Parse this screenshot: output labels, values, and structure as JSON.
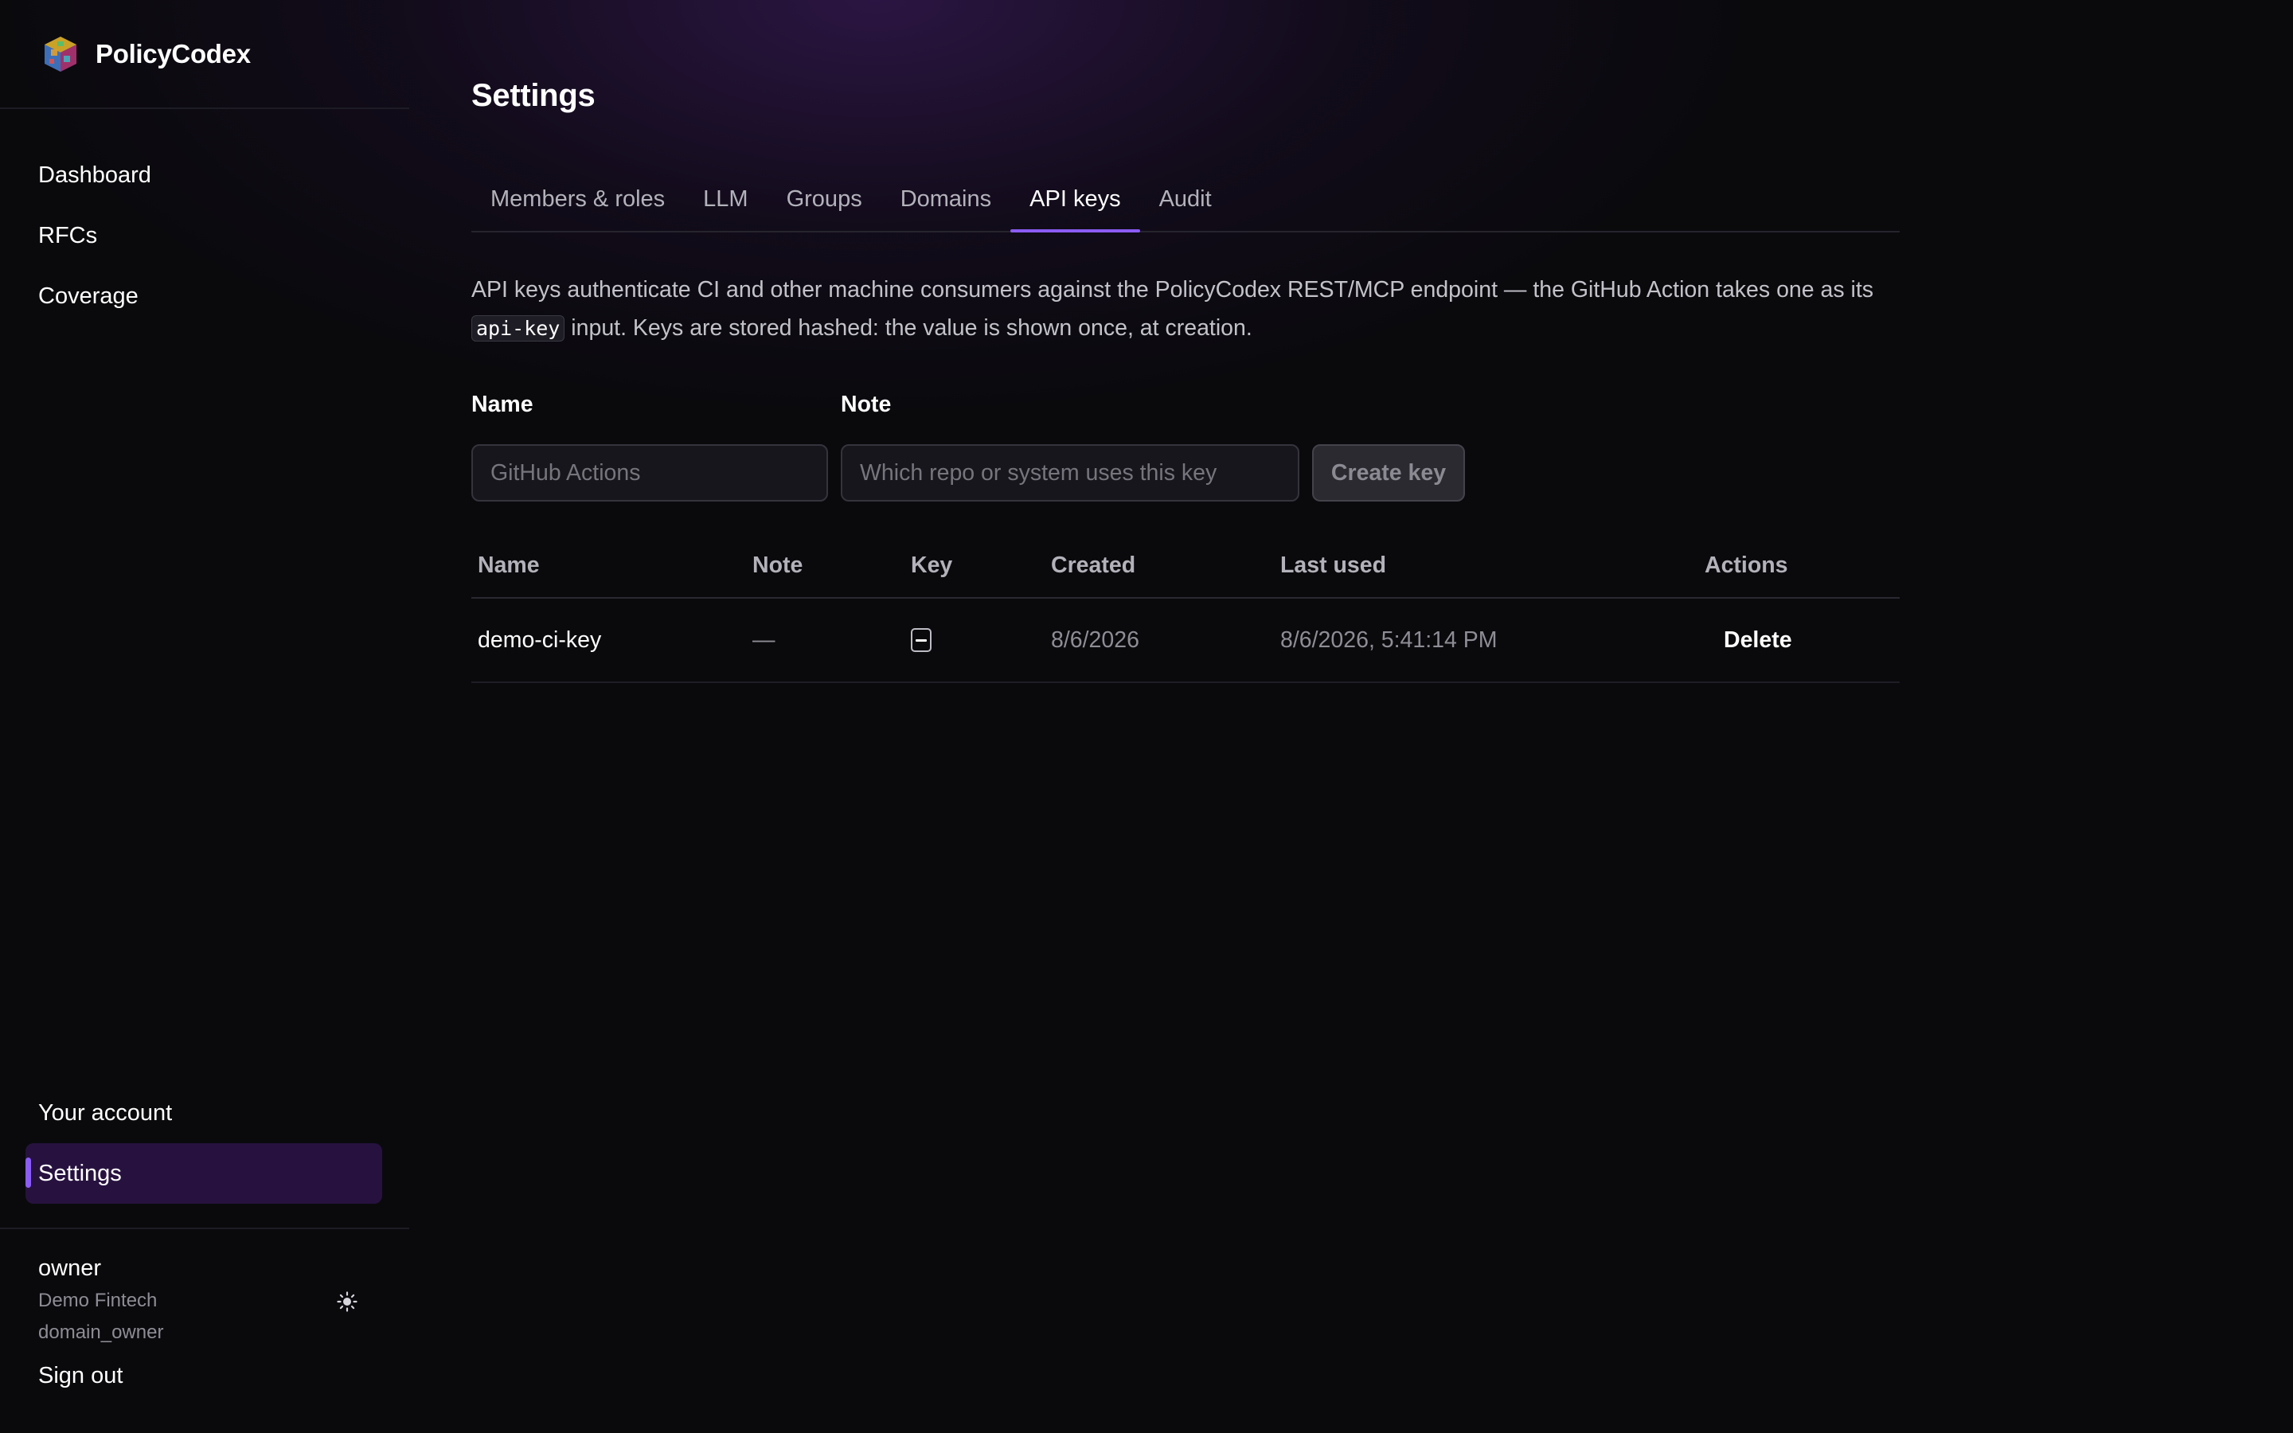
{
  "app": {
    "name": "PolicyCodex"
  },
  "sidebar": {
    "nav": [
      {
        "label": "Dashboard"
      },
      {
        "label": "RFCs"
      },
      {
        "label": "Coverage"
      }
    ],
    "bottom_nav": [
      {
        "label": "Your account"
      },
      {
        "label": "Settings",
        "active": true
      }
    ],
    "user": {
      "name": "owner",
      "org": "Demo Fintech",
      "role": "domain_owner"
    },
    "theme_toggle_icon": "sun-icon",
    "sign_out_label": "Sign out"
  },
  "main": {
    "title": "Settings",
    "tabs": [
      {
        "label": "Members & roles"
      },
      {
        "label": "LLM"
      },
      {
        "label": "Groups"
      },
      {
        "label": "Domains"
      },
      {
        "label": "API keys",
        "active": true
      },
      {
        "label": "Audit"
      }
    ],
    "description": {
      "part1": "API keys authenticate CI and other machine consumers against the PolicyCodex REST/MCP endpoint — the GitHub Action takes one as its",
      "code": "api-key",
      "part2": "input. Keys are stored hashed: the value is shown once, at creation."
    },
    "form": {
      "name_label": "Name",
      "name_placeholder": "GitHub Actions",
      "name_value": "",
      "note_label": "Note",
      "note_placeholder": "Which repo or system uses this key",
      "note_value": "",
      "create_label": "Create key"
    },
    "table": {
      "columns": [
        "Name",
        "Note",
        "Key",
        "Created",
        "Last used",
        "Actions"
      ],
      "rows": [
        {
          "name": "demo-ci-key",
          "note": "—",
          "key_icon": "masked-key-icon",
          "created": "8/6/2026",
          "last_used": "8/6/2026, 5:41:14 PM",
          "action_label": "Delete"
        }
      ]
    }
  },
  "colors": {
    "accent": "#8b5cf6",
    "active_nav_bg": "#27123f",
    "background": "#0a0a0d"
  }
}
